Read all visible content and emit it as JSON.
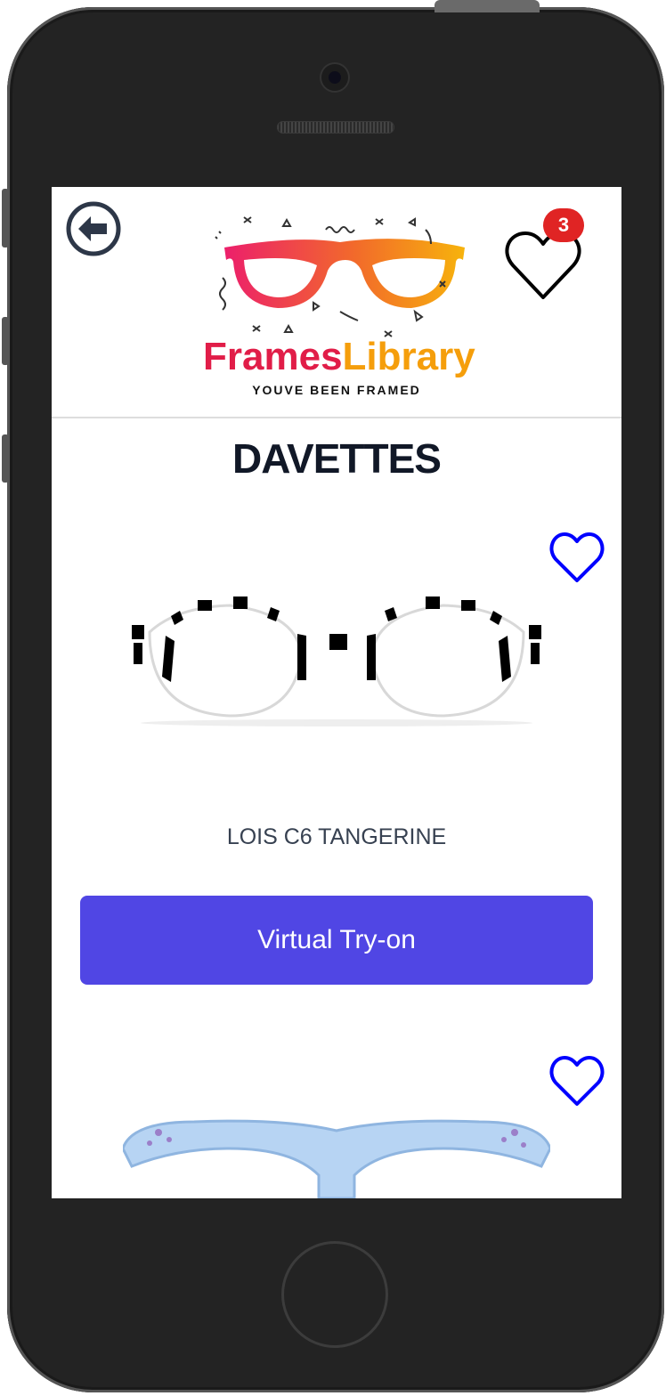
{
  "header": {
    "brand_part1": "Frames",
    "brand_part2": "Library",
    "tagline": "YOUVE BEEN FRAMED",
    "wishlist_count": "3",
    "icons": [
      "arrow-left-circle-icon",
      "heart-icon"
    ]
  },
  "page": {
    "title": "DAVETTES"
  },
  "products": [
    {
      "name": "LOIS C6 TANGERINE",
      "button_label": "Virtual Try-on"
    },
    {
      "name": "",
      "button_label": ""
    }
  ],
  "colors": {
    "primary_button": "#5046e4",
    "badge": "#e02424",
    "favorite_heart": "#0000ff",
    "brand_red": "#e11d48",
    "brand_orange": "#f59e0b"
  }
}
